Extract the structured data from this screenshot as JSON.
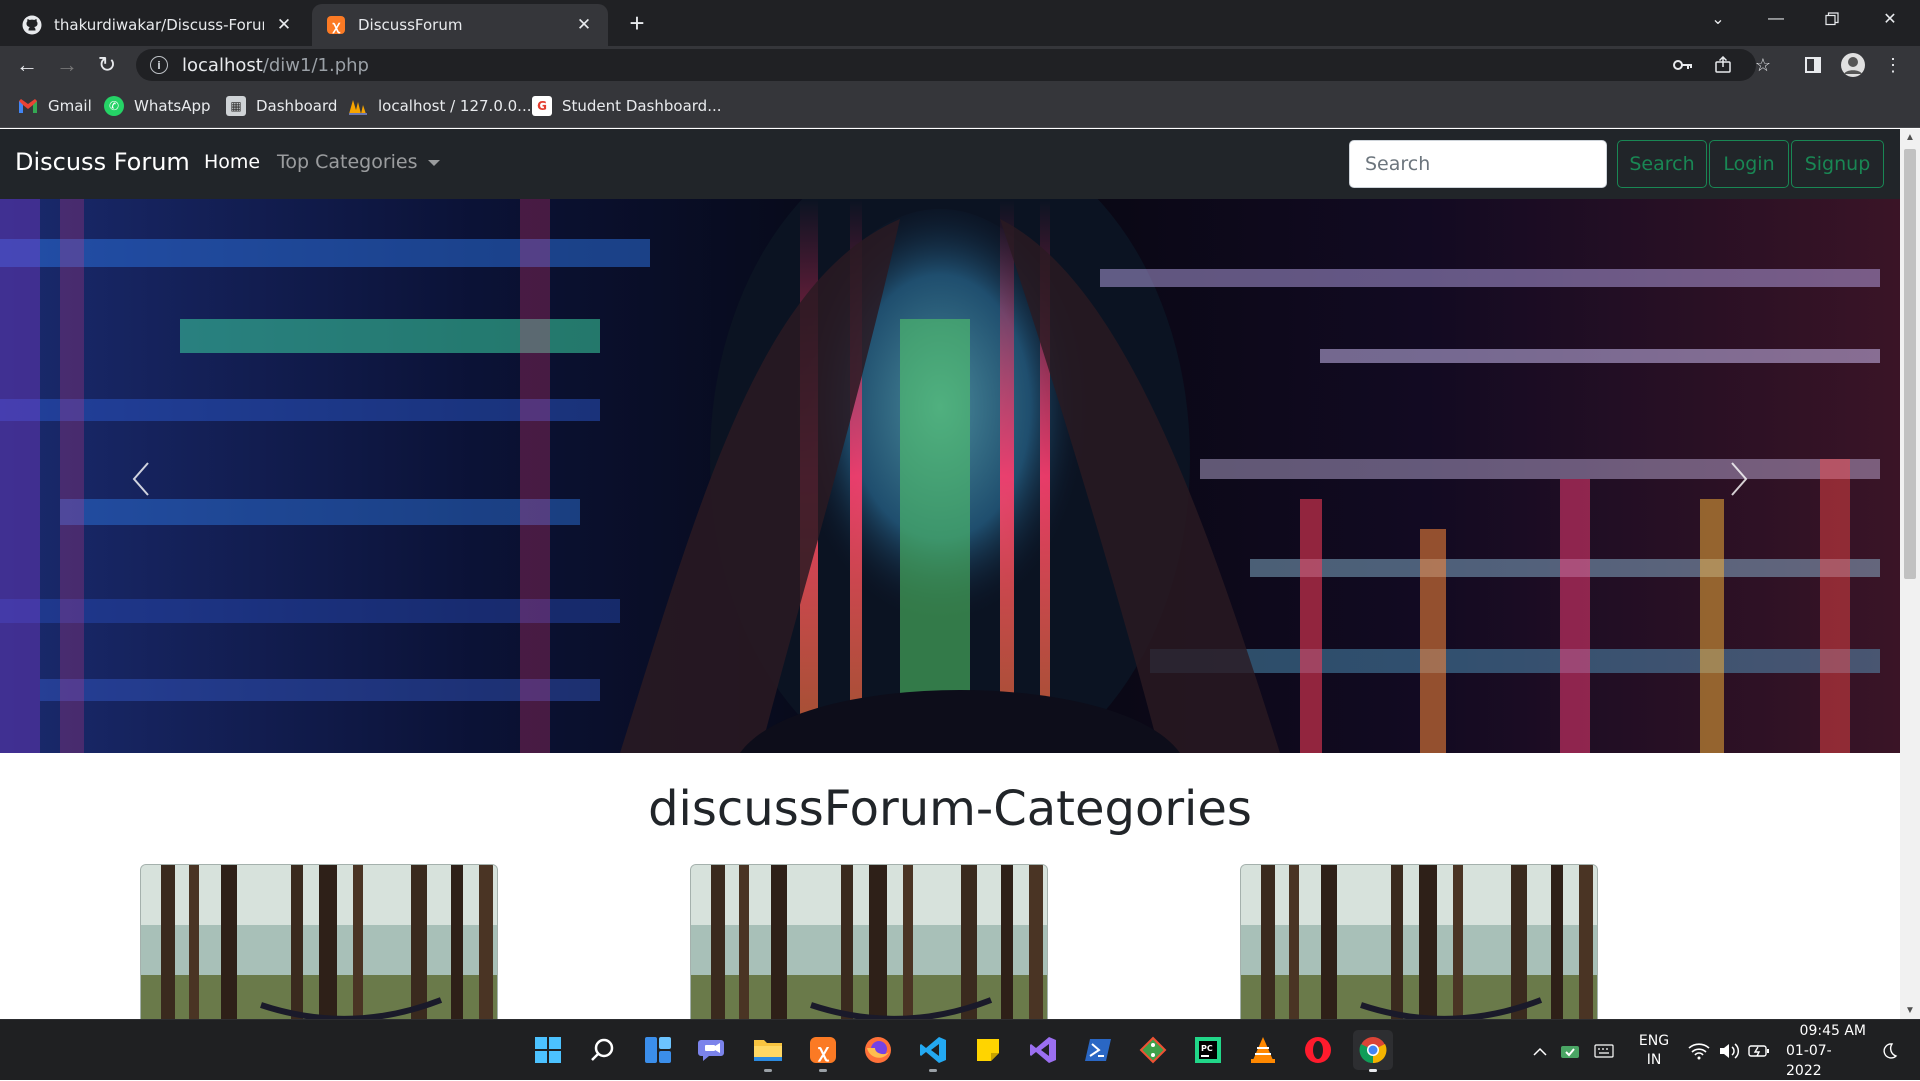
{
  "browser": {
    "tabs": [
      {
        "title": "thakurdiwakar/Discuss-Forum: Th",
        "icon": "github-icon",
        "active": false
      },
      {
        "title": "DiscussForum",
        "icon": "xampp-icon",
        "active": true
      }
    ],
    "address": {
      "host": "localhost",
      "path": "/diw1/1.php"
    },
    "bookmarks": [
      {
        "label": "Gmail",
        "icon": "gmail-icon"
      },
      {
        "label": "WhatsApp",
        "icon": "whatsapp-icon"
      },
      {
        "label": "Dashboard",
        "icon": "dashboard-icon"
      },
      {
        "label": "localhost / 127.0.0....",
        "icon": "phpmyadmin-icon"
      },
      {
        "label": "Student Dashboard...",
        "icon": "student-dashboard-icon"
      }
    ]
  },
  "site": {
    "brand": "Discuss Forum",
    "nav": {
      "home": "Home",
      "categories": "Top Categories"
    },
    "search": {
      "placeholder": "Search",
      "button": "Search"
    },
    "login": "Login",
    "signup": "Signup",
    "heading": "discussForum-Categories",
    "card_count": 3
  },
  "taskbar": {
    "apps": [
      "windows-start-icon",
      "search-icon",
      "widgets-icon",
      "teams-chat-icon",
      "file-explorer-icon",
      "xampp-icon",
      "firefox-icon",
      "vscode-icon",
      "sticky-notes-icon",
      "visual-studio-icon",
      "powershell-icon",
      "git-icon",
      "pycharm-icon",
      "vlc-icon",
      "opera-icon",
      "chrome-icon"
    ],
    "lang": {
      "line1": "ENG",
      "line2": "IN"
    },
    "time": "09:45 AM",
    "date": "01-07-2022"
  },
  "colors": {
    "nav_bg": "#212529",
    "success": "#198754",
    "chrome_dark": "#202124",
    "chrome_toolbar": "#35363a"
  }
}
